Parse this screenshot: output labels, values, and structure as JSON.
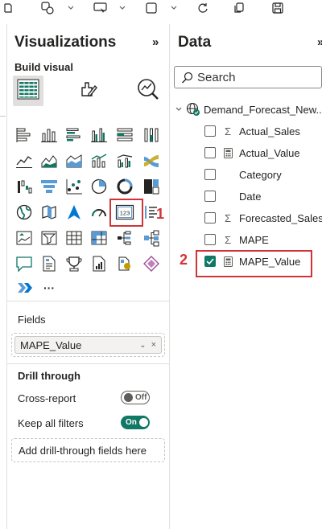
{
  "colors": {
    "accent": "#117865",
    "highlight": "#d13438",
    "text": "#252423",
    "border": "#e1dfdd"
  },
  "toolbar": {
    "icons": [
      "shapes-icon",
      "chevron-down-icon",
      "buttons-icon",
      "chevron-down-icon",
      "visual-gallery-icon",
      "chevron-down-icon",
      "refresh-icon",
      "copy-icon",
      "save-icon"
    ]
  },
  "visualizations": {
    "title": "Visualizations",
    "collapse_glyph": "»",
    "build_visual_label": "Build visual",
    "modes": [
      "build-visual-icon",
      "format-visual-icon",
      "analytics-icon"
    ],
    "more_glyph": "···",
    "fields_label": "Fields",
    "field_value": "MAPE_Value",
    "field_chevron": "⌄",
    "field_remove": "×",
    "drill_through_label": "Drill through",
    "cross_report_label": "Cross-report",
    "cross_report_toggle": "Off",
    "keep_filters_label": "Keep all filters",
    "keep_filters_toggle": "On",
    "drill_placeholder": "Add drill-through fields here",
    "card_icon_text": "123",
    "annotation_1": "1"
  },
  "data": {
    "title": "Data",
    "collapse_glyph": "»",
    "search_placeholder": "Search",
    "table_name": "Demand_Forecast_New...",
    "annotation_2": "2",
    "fields": [
      {
        "type": "sigma",
        "type_glyph": "Σ",
        "name": "Actual_Sales",
        "checked": false
      },
      {
        "type": "calc",
        "type_glyph": "",
        "name": "Actual_Value",
        "checked": false
      },
      {
        "type": "none",
        "type_glyph": "",
        "name": "Category",
        "checked": false
      },
      {
        "type": "none",
        "type_glyph": "",
        "name": "Date",
        "checked": false
      },
      {
        "type": "sigma",
        "type_glyph": "Σ",
        "name": "Forecasted_Sales",
        "checked": false
      },
      {
        "type": "sigma",
        "type_glyph": "Σ",
        "name": "MAPE",
        "checked": false
      },
      {
        "type": "calc",
        "type_glyph": "",
        "name": "MAPE_Value",
        "checked": true
      }
    ]
  }
}
